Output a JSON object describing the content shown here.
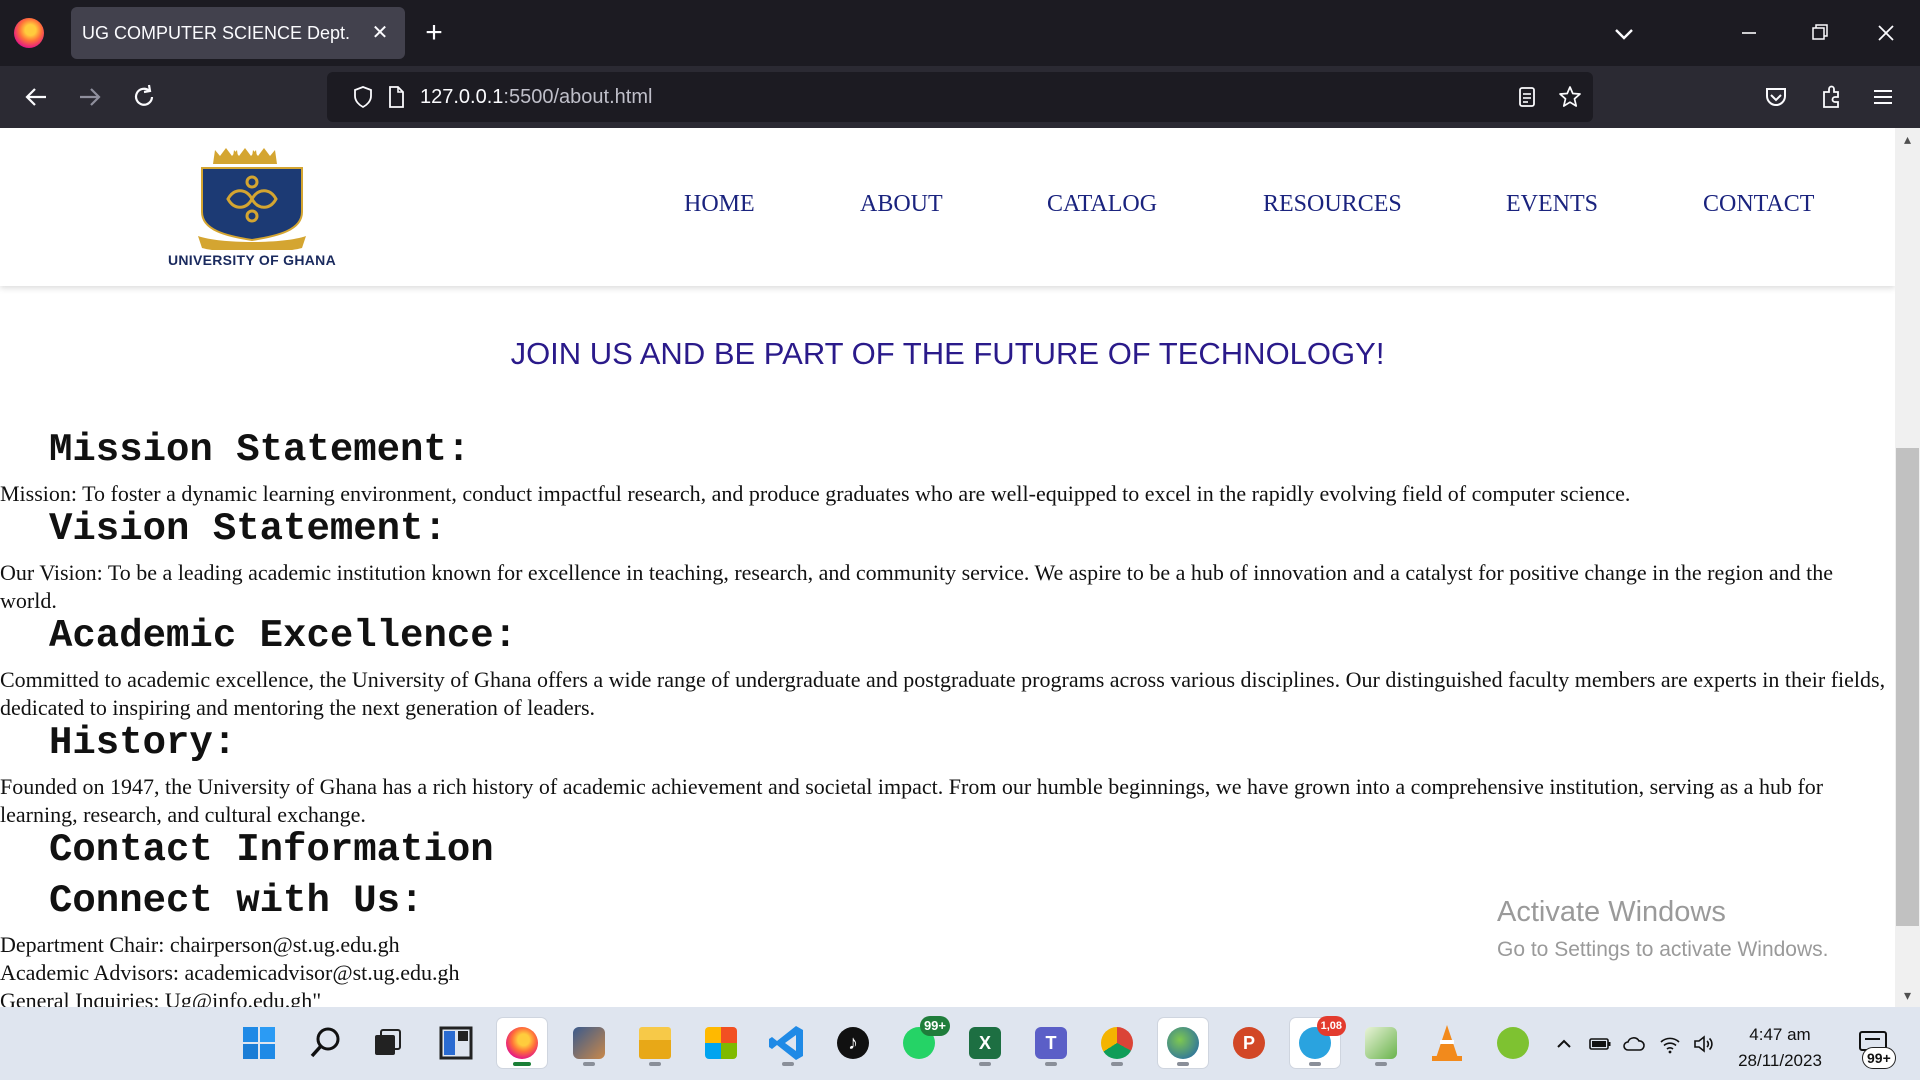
{
  "browser": {
    "tab_title": "UG COMPUTER SCIENCE Dept.",
    "url_host": "127.0.0.1",
    "url_path": ":5500/about.html"
  },
  "site": {
    "logo_text": "UNIVERSITY OF GHANA",
    "nav": [
      "HOME",
      "ABOUT",
      "CATALOG",
      "RESOURCES",
      "EVENTS",
      "CONTACT"
    ],
    "tagline": "JOIN US AND BE PART OF THE FUTURE OF TECHNOLOGY!",
    "sections": {
      "mission_heading": "Mission Statement:",
      "mission_text": "Mission: To foster a dynamic learning environment, conduct impactful research, and produce graduates who are well-equipped to excel in the rapidly evolving field of computer science.",
      "vision_heading": "Vision Statement:",
      "vision_text": "Our Vision: To be a leading academic institution known for excellence in teaching, research, and community service. We aspire to be a hub of innovation and a catalyst for positive change in the region and the world.",
      "academic_heading": "Academic Excellence:",
      "academic_text": "Committed to academic excellence, the University of Ghana offers a wide range of undergraduate and postgraduate programs across various disciplines. Our distinguished faculty members are experts in their fields, dedicated to inspiring and mentoring the next generation of leaders.",
      "history_heading": "History:",
      "history_text": "Founded on 1947, the University of Ghana has a rich history of academic achievement and societal impact. From our humble beginnings, we have grown into a comprehensive institution, serving as a hub for learning, research, and cultural exchange.",
      "contact_heading": "Contact Information",
      "connect_heading": "Connect with Us:",
      "contact_lines": [
        "Department Chair: chairperson@st.ug.edu.gh",
        "Academic Advisors: academicadvisor@st.ug.edu.gh",
        "General Inquiries: Ug@info.edu.gh\""
      ]
    }
  },
  "watermark": {
    "line1": "Activate Windows",
    "line2": "Go to Settings to activate Windows."
  },
  "taskbar": {
    "time": "4:47 am",
    "date": "28/11/2023",
    "whatsapp_badge": "99+",
    "telegram_badge": "1,08",
    "notification_badge": "99+"
  },
  "colors": {
    "nav_text": "#1a237e",
    "tagline": "#2a1a8a",
    "chrome_bg": "#1c1b22",
    "toolbar_bg": "#2b2a33",
    "taskbar_bg": "#dfe5ef"
  }
}
